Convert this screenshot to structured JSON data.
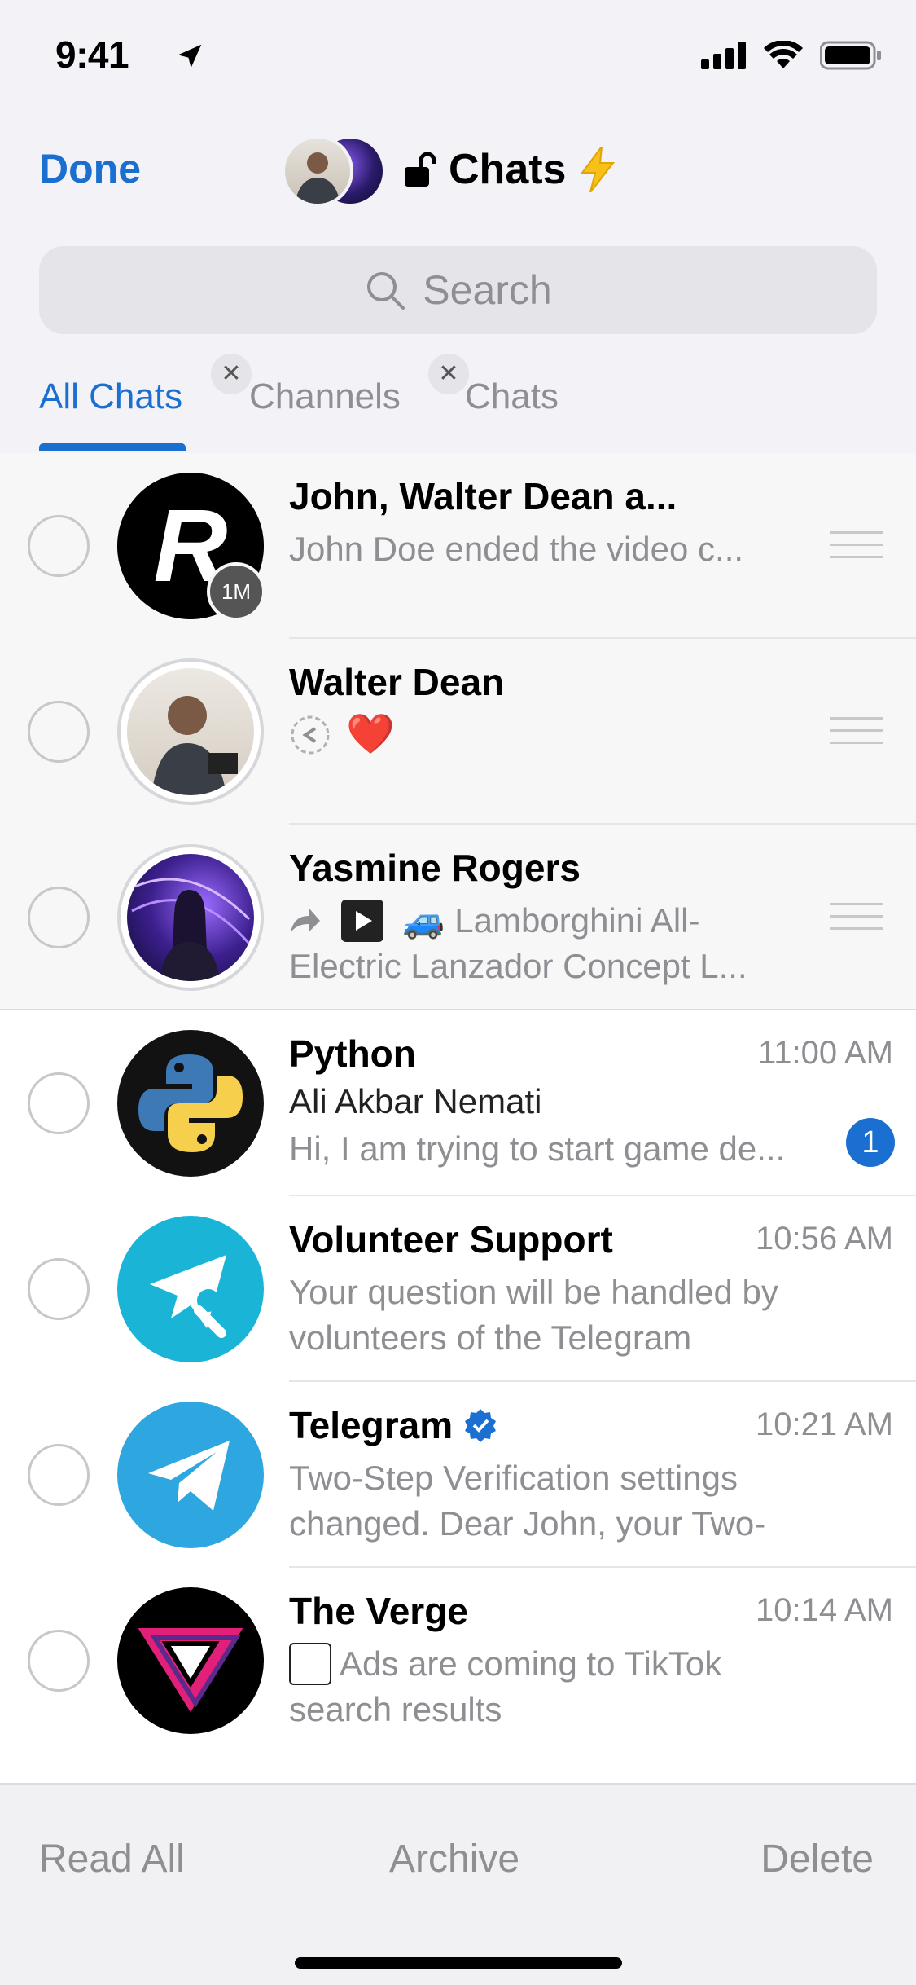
{
  "status": {
    "time": "9:41"
  },
  "header": {
    "done_label": "Done",
    "title": "Chats"
  },
  "search": {
    "placeholder": "Search"
  },
  "tabs": [
    {
      "label": "All Chats",
      "active": true
    },
    {
      "label": "Channels",
      "removable": true
    },
    {
      "label": "Chats",
      "removable": true
    }
  ],
  "chats": [
    {
      "name": "John, Walter Dean a...",
      "message": "John Doe ended the video c...",
      "pinned": true,
      "avatar_letter": "R",
      "avatar_tag": "1M"
    },
    {
      "name": "Walter Dean",
      "message": "❤️",
      "pinned": true
    },
    {
      "name": "Yasmine Rogers",
      "message": "🚙 Lamborghini All-Electric Lanzador Concept L...",
      "pinned": true
    },
    {
      "name": "Python",
      "time": "11:00 AM",
      "sender": "Ali Akbar Nemati",
      "message": "Hi, I am trying to start game de...",
      "unread": "1"
    },
    {
      "name": "Volunteer Support",
      "time": "10:56 AM",
      "message": "Your question will be handled by volunteers of the Telegram Suppor..."
    },
    {
      "name": "Telegram",
      "time": "10:21 AM",
      "message": "Two-Step Verification settings changed. Dear John, your Two-St...",
      "verified": true
    },
    {
      "name": "The Verge",
      "time": "10:14 AM",
      "message": "Ads are coming to TikTok search results https://www.theverge.com/..."
    }
  ],
  "toolbar": {
    "read_all": "Read All",
    "archive": "Archive",
    "delete": "Delete"
  },
  "colors": {
    "accent": "#1a6fd0",
    "secondary_text": "#8e8e93",
    "volunteer": "#1ab4d6",
    "telegram": "#2ea6e0"
  }
}
